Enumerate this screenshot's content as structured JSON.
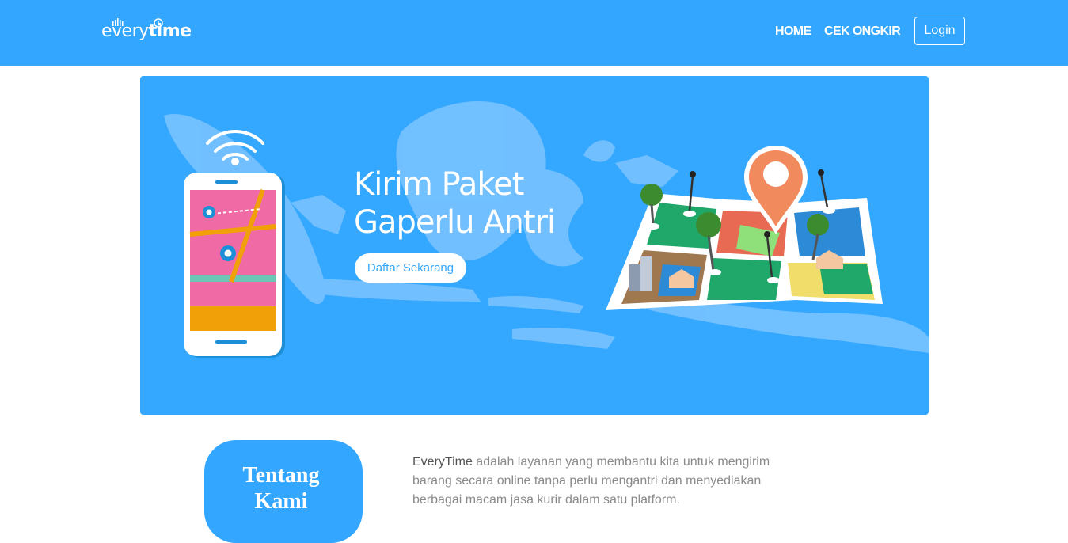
{
  "brand": {
    "logo_light": "every",
    "logo_bold": "time"
  },
  "nav": {
    "home": "HOME",
    "cek_ongkir": "CEK ONGKIR",
    "login": "Login"
  },
  "hero": {
    "title_line1": "Kirim Paket",
    "title_line2": "Gaperlu Antri",
    "cta": "Daftar Sekarang"
  },
  "about": {
    "title_line1": "Tentang",
    "title_line2": "Kami",
    "brand_name": "EveryTime",
    "description": " adalah layanan yang membantu kita untuk mengirim barang secara online tanpa perlu mengantri dan menyediakan berbagai macam jasa kurir dalam satu platform."
  },
  "colors": {
    "primary": "#33a6ff",
    "hero_bg": "#34a7fe",
    "text_muted": "#8a8a8a"
  },
  "icons": [
    "phone-map-illustration",
    "wifi-icon",
    "location-pin-icon",
    "city-map-illustration",
    "indonesia-map-background"
  ]
}
